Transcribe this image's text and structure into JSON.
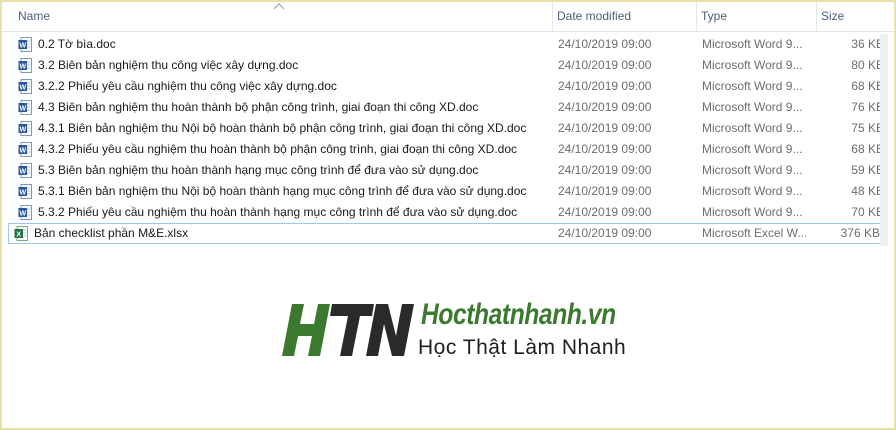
{
  "columns": {
    "name": "Name",
    "date": "Date modified",
    "type": "Type",
    "size": "Size"
  },
  "files": [
    {
      "name": "0.2 Tờ bìa.doc",
      "date": "24/10/2019 09:00",
      "type": "Microsoft Word 9...",
      "size": "36 KB",
      "icon": "word-doc-icon"
    },
    {
      "name": "3.2 Biên bản nghiệm thu công việc xây dựng.doc",
      "date": "24/10/2019 09:00",
      "type": "Microsoft Word 9...",
      "size": "80 KB",
      "icon": "word-doc-icon"
    },
    {
      "name": "3.2.2 Phiếu yêu cầu nghiệm thu công việc xây dựng.doc",
      "date": "24/10/2019 09:00",
      "type": "Microsoft Word 9...",
      "size": "68 KB",
      "icon": "word-doc-icon"
    },
    {
      "name": "4.3 Biên bản nghiệm thu hoàn thành bộ phận công trình, giai đoạn thi công XD.doc",
      "date": "24/10/2019 09:00",
      "type": "Microsoft Word 9...",
      "size": "76 KB",
      "icon": "word-doc-icon"
    },
    {
      "name": "4.3.1 Biên bản nghiệm thu Nội bộ hoàn thành bộ phận công trình, giai đoạn thi công XD.doc",
      "date": "24/10/2019 09:00",
      "type": "Microsoft Word 9...",
      "size": "75 KB",
      "icon": "word-doc-icon"
    },
    {
      "name": "4.3.2 Phiếu yêu cầu nghiệm thu hoàn thành bộ phận công trình, giai đoạn thi công XD.doc",
      "date": "24/10/2019 09:00",
      "type": "Microsoft Word 9...",
      "size": "68 KB",
      "icon": "word-doc-icon"
    },
    {
      "name": "5.3 Biên bản nghiệm thu hoàn thành hạng mục công trình để đưa vào sử dụng.doc",
      "date": "24/10/2019 09:00",
      "type": "Microsoft Word 9...",
      "size": "59 KB",
      "icon": "word-doc-icon"
    },
    {
      "name": "5.3.1 Biên bản nghiệm thu Nội bộ hoàn thành hạng mục công trình để đưa vào sử dụng.doc",
      "date": "24/10/2019 09:00",
      "type": "Microsoft Word 9...",
      "size": "48 KB",
      "icon": "word-doc-icon"
    },
    {
      "name": "5.3.2 Phiếu yêu cầu nghiệm thu hoàn thành hạng mục công trình để đưa vào sử dụng.doc",
      "date": "24/10/2019 09:00",
      "type": "Microsoft Word 9...",
      "size": "70 KB",
      "icon": "word-doc-icon"
    },
    {
      "name": "Bản checklist phần M&E.xlsx",
      "date": "24/10/2019 09:00",
      "type": "Microsoft Excel W...",
      "size": "376 KB",
      "icon": "excel-xlsx-icon"
    }
  ],
  "watermark": {
    "mark": "HTN",
    "domain": "Hocthatnhanh.vn",
    "slogan": "Học Thật  Làm Nhanh"
  },
  "colors": {
    "header_text": "#4c607a",
    "word_blue": "#2b579a",
    "excel_green": "#217346",
    "logo_green": "#3b7a2e",
    "logo_dark": "#2a2a2a",
    "frame": "#e9dfa8",
    "selection": "#99c9ef"
  }
}
